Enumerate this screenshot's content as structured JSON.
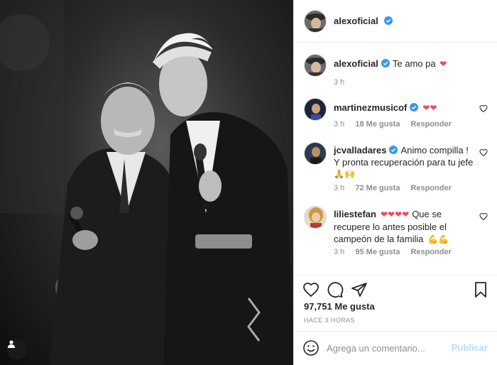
{
  "post": {
    "author": "alexoficial",
    "verified": true,
    "caption": {
      "username": "alexoficial",
      "text": "Te amo pa",
      "emoji": "❤",
      "time": "3 h"
    },
    "comments": [
      {
        "username": "martinezmusicof",
        "verified": true,
        "text": "",
        "emoji": "❤❤",
        "time": "3 h",
        "likes": "18 Me gusta",
        "reply": "Responder"
      },
      {
        "username": "jcvalladares",
        "verified": true,
        "text": "Animo compilla ! Y pronta recuperación para tu jefe",
        "emoji": "🙏🙌",
        "time": "3 h",
        "likes": "72 Me gusta",
        "reply": "Responder"
      },
      {
        "username": "liliestefan",
        "verified": false,
        "text": "Que se recupere lo antes posible el campeón de la familia",
        "emoji_lead": "❤❤❤❤",
        "emoji": "💪💪",
        "time": "3 h",
        "likes": "95 Me gusta",
        "reply": "Responder"
      }
    ],
    "likes_count": "97,751 Me gusta",
    "posted_ago": "HACE 3 HORAS",
    "comment_box": {
      "placeholder": "Agrega un comentario...",
      "submit_label": "Publicar"
    }
  },
  "icons": {
    "verified": "verified-badge-icon",
    "like": "heart-outline-icon",
    "comment": "comment-bubble-icon",
    "share": "paper-plane-icon",
    "save": "bookmark-icon",
    "emoji": "smiley-icon",
    "tag": "user-tag-icon"
  },
  "colors": {
    "verified_blue": "#3897f0",
    "heart_red": "#ed4956",
    "publish_disabled": "#b3dbff",
    "muted_text": "#8e8e8e"
  }
}
